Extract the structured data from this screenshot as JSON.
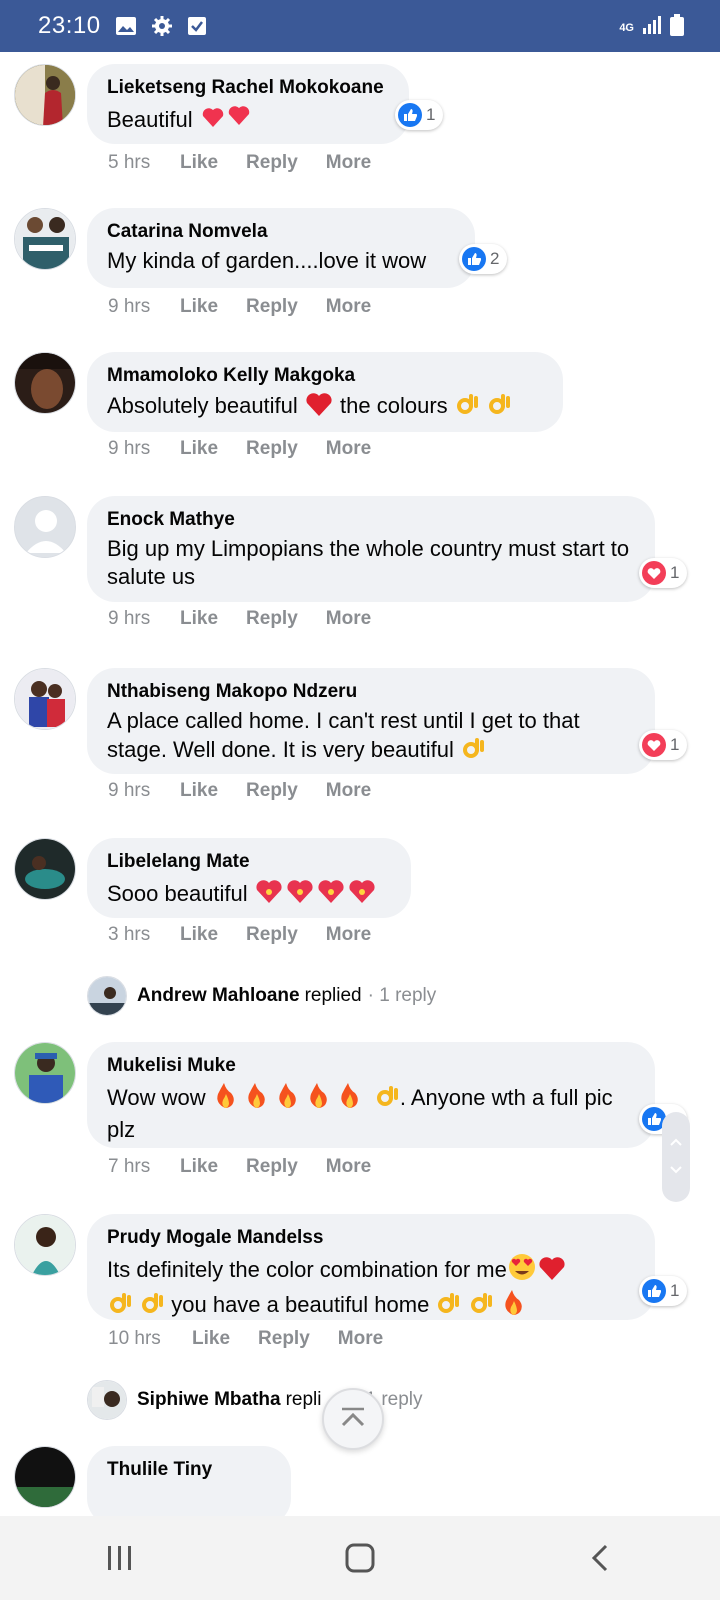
{
  "status_bar": {
    "time": "23:10",
    "network": "4G",
    "icons": [
      "image-icon",
      "gear-icon",
      "checkbox-icon",
      "signal-icon",
      "battery-icon"
    ]
  },
  "actions": {
    "like": "Like",
    "reply": "Reply",
    "more": "More"
  },
  "comments": [
    {
      "name": "Lieketseng Rachel Mokokoane",
      "text": "Beautiful",
      "time": "5 hrs",
      "reaction": "like",
      "reaction_count": "1"
    },
    {
      "name": "Catarina Nomvela",
      "text": "My kinda of garden....love it wow",
      "time": "9 hrs",
      "reaction": "like",
      "reaction_count": "2"
    },
    {
      "name": "Mmamoloko Kelly Makgoka",
      "text_a": "Absolutely beautiful",
      "text_b": "the colours",
      "time": "9 hrs"
    },
    {
      "name": "Enock Mathye",
      "text": "Big up my Limpopians the whole country must start to salute us",
      "time": "9 hrs",
      "reaction": "love",
      "reaction_count": "1"
    },
    {
      "name": "Nthabiseng Makopo Ndzeru",
      "text": "A place called home. I can't rest until I get to that stage. Well done. It is very beautiful",
      "time": "9 hrs",
      "reaction": "love",
      "reaction_count": "1"
    },
    {
      "name": "Libelelang Mate",
      "text": "Sooo beautiful",
      "time": "3 hrs"
    },
    {
      "name": "Mukelisi Muke",
      "text_a": "Wow wow",
      "text_b": ". Anyone wth a full pic plz",
      "time": "7 hrs",
      "reaction": "like",
      "reaction_count": "1"
    },
    {
      "name": "Prudy Mogale Mandelss",
      "text_a": "Its definitely the color combination for me",
      "text_b": "you have a beautiful home",
      "time": "10 hrs",
      "reaction": "like",
      "reaction_count": "1"
    },
    {
      "name": "Thulile Tiny"
    }
  ],
  "replies": [
    {
      "name": "Andrew Mahloane",
      "verb": "replied",
      "count": "· 1 reply"
    },
    {
      "name": "Siphiwe Mbatha",
      "verb": "repli",
      "count": "1 reply"
    }
  ],
  "colors": {
    "brand": "#3b5997",
    "like": "#1877f2",
    "love": "#f33e58",
    "bubble": "#f0f2f5"
  }
}
